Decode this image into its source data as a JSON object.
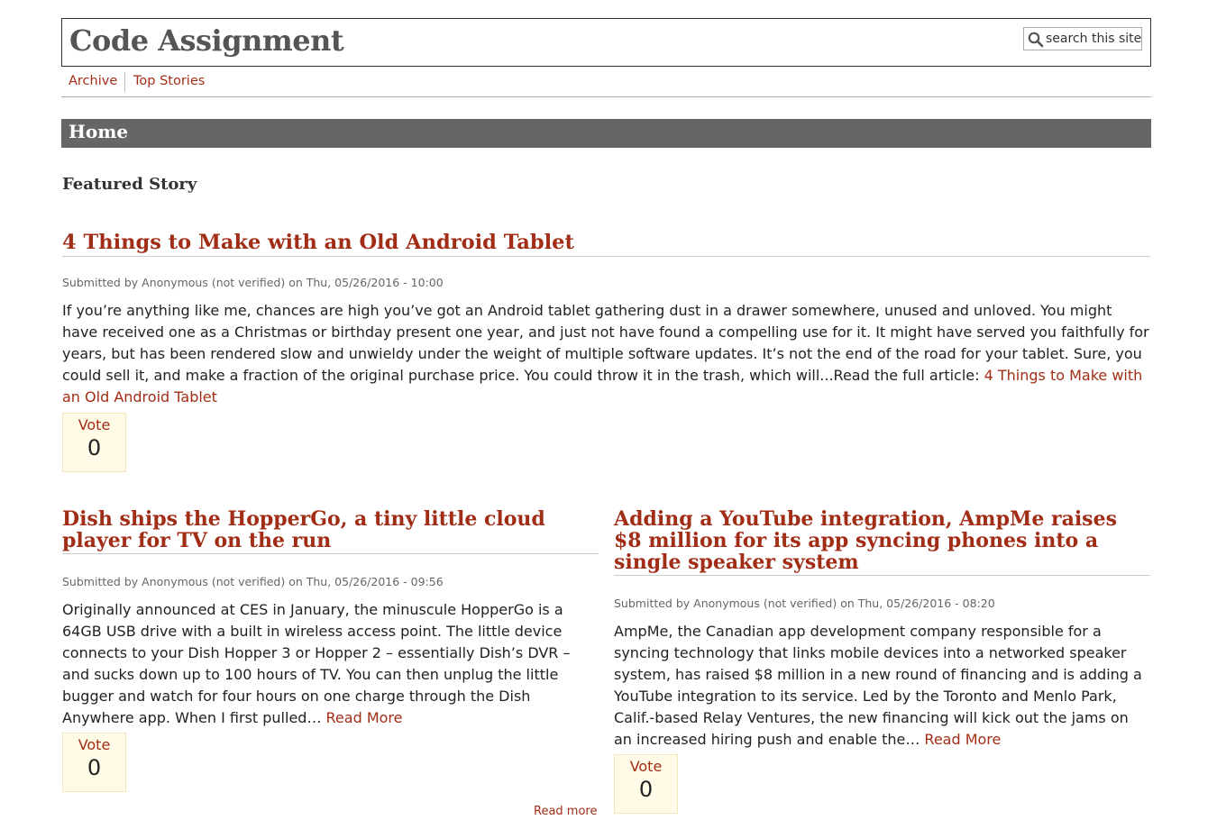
{
  "site": {
    "title": "Code Assignment",
    "search_placeholder": "search this site",
    "search_icon": "magnifier-icon"
  },
  "nav": {
    "items": [
      {
        "label": "Archive"
      },
      {
        "label": "Top Stories"
      }
    ]
  },
  "page": {
    "title": "Home",
    "section_heading": "Featured Story"
  },
  "featured": {
    "title": "4 Things to Make with an Old Android Tablet",
    "meta": "Submitted by Anonymous (not verified) on Thu, 05/26/2016 - 10:00",
    "body": "If you’re anything like me, chances are high you’ve got an Android tablet gathering dust in a drawer somewhere, unused and unloved. You might have received one as a Christmas or birthday present one year, and just not have found a compelling use for it. It might have served you faithfully for years, but has been rendered slow and unwieldy under the weight of multiple software updates. It’s not the end of the road for your tablet. Sure, you could sell it, and make a fraction of the original purchase price. You could throw it in the trash, which will...Read the full article: ",
    "link": "4 Things to Make with an Old Android Tablet",
    "vote_label": "Vote",
    "vote_count": "0"
  },
  "stories": [
    {
      "title": "Dish ships the HopperGo, a tiny little cloud player for TV on the run",
      "meta": "Submitted by Anonymous (not verified) on Thu, 05/26/2016 - 09:56",
      "body": " Originally announced at CES in January, the minuscule HopperGo is a 64GB USB drive with a built in wireless access point. The little device connects to your Dish Hopper 3 or Hopper 2 – essentially Dish’s DVR – and sucks down up to 100 hours of TV. You can then unplug the little bugger and watch for four hours on one charge through the Dish Anywhere app. When I first pulled… ",
      "link": "Read More",
      "vote_label": "Vote",
      "vote_count": "0"
    },
    {
      "title": "Adding a YouTube integration, AmpMe raises $8 million for its app syncing phones into a single speaker system",
      "meta": "Submitted by Anonymous (not verified) on Thu, 05/26/2016 - 08:20",
      "body": " AmpMe, the Canadian app development company responsible for a syncing technology that links mobile devices into a networked speaker system, has raised $8 million in a new round of financing and is adding a YouTube integration to its service. Led by the Toronto and Menlo Park, Calif.-based Relay Ventures, the new financing will kick out the jams on an increased hiring push and enable the… ",
      "link": "Read More",
      "vote_label": "Vote",
      "vote_count": "0"
    }
  ],
  "footer": {
    "read_more": "Read more"
  },
  "colors": {
    "accent": "#a12d16",
    "bar": "#666666",
    "vote_bg": "#fffbe6"
  }
}
